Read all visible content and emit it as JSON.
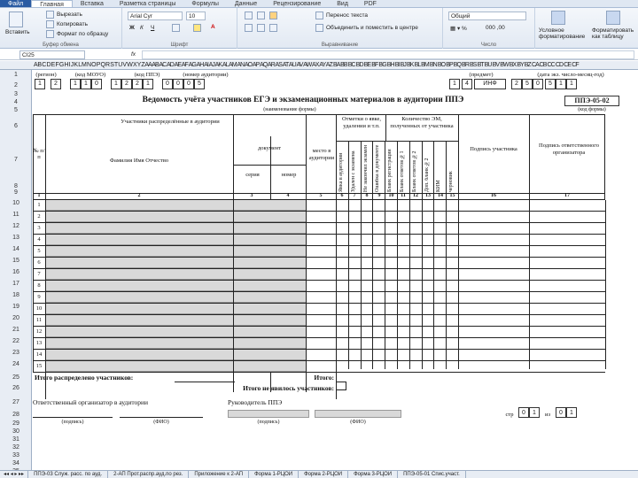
{
  "tabs": [
    "Файл",
    "Главная",
    "Вставка",
    "Разметка страницы",
    "Формулы",
    "Данные",
    "Рецензирование",
    "Вид",
    "PDF"
  ],
  "ribbon": {
    "cut": "Вырезать",
    "copy": "Копировать",
    "paste": "Вставить",
    "format_painter": "Формат по образцу",
    "clipboard_group": "Буфер обмена",
    "font_name": "Arial Cyr",
    "font_size": "10",
    "font_group": "Шрифт",
    "wrap_text": "Перенос текста",
    "merge_center": "Объединить и поместить в центре",
    "alignment_group": "Выравнивание",
    "number_format": "Общий",
    "number_group": "Число",
    "conditional": "Условное форматирование",
    "format_table": "Форматировать как таблицу"
  },
  "formula_bar": {
    "name_box": "CI25",
    "fx": "fx",
    "value": ""
  },
  "column_headers": "A B C D E F G H I J K L M N O P Q R S T U V W X Y Z AA AB AC AD AE AF AG AH AI AJ AK AL AM AN AO AP AQ AR AS AT AU AV AW AX AY AZ BA BB BC BD BE BF BG BH BI BJ BK BL BM BN BO BP BQ BR BS BT BU BV BW BX BY BZ CA CB CC CD CE CF",
  "form": {
    "region_label": "(регион)",
    "mouo_label": "(код МОУО)",
    "ppe_code_label": "(код ППЭ)",
    "room_label": "(номер аудитории)",
    "subject_label": "(предмет)",
    "date_label": "(дата экз. число-месяц-год)",
    "row2_left": [
      "1",
      "2",
      "1",
      "1",
      "0",
      "1",
      "2",
      "2",
      "1",
      "0",
      "0",
      "0",
      "5"
    ],
    "row2_right": [
      "1",
      "4",
      "ИНФ",
      "2",
      "5",
      "0",
      "5",
      "1",
      "1"
    ],
    "title": "Ведомость учёта участников ЕГЭ и экзаменационных материалов в аудитории ППЭ",
    "form_code": "ППЭ-05-02",
    "title_note": "(наименование формы)",
    "form_code_note": "(код формы)",
    "participants_header": "Участники распределённые в аудитории",
    "marks_header": "Отметки о явке, удалении и т.п.",
    "em_header": "Количество ЭМ, полученных от участника",
    "no_label": "№ п/п",
    "fio_label": "Фамилия Имя Отчество",
    "document_label": "документ",
    "series_label": "серия",
    "number_label": "номер",
    "seat_label": "место в аудитории",
    "vertical_labels": [
      "Явка в аудитории",
      "Удален с экзамена",
      "Не закончил экзамен",
      "Ошибка в документе",
      "Бланк регистрации",
      "Бланк ответов №1",
      "Бланк ответов №2",
      "Доп. бланк №2",
      "КИМ",
      "черновик"
    ],
    "signature_participant": "Подпись участника",
    "signature_organizer": "Подпись ответственного организатора",
    "col_numbers": [
      "1",
      "2",
      "3",
      "4",
      "5",
      "6",
      "7",
      "8",
      "9",
      "10",
      "11",
      "12",
      "13",
      "14",
      "15",
      "16",
      "17"
    ],
    "row_indices": [
      "1",
      "2",
      "3",
      "4",
      "5",
      "6",
      "7",
      "8",
      "9",
      "10",
      "11",
      "12",
      "13",
      "14",
      "15"
    ],
    "distributed": "Итого распределено участников:",
    "total": "Итого:",
    "absent": "Итого не явилось участников:",
    "organizer": "Ответственный организатор в аудитории",
    "ppe_head": "Руководитель ППЭ",
    "signature_note": "(подпись)",
    "fio_note": "(ФИО)",
    "page_label": "стр",
    "page_of": "из",
    "page_num": [
      "0",
      "1"
    ],
    "page_total": [
      "0",
      "1"
    ]
  },
  "sheet_tabs": [
    "ППЭ-03 Служ. расс. по ауд.",
    "2-АП Прот.распр.ауд.по рез.",
    "Приложение к 2-АП",
    "Форма 1-РЦОИ",
    "Форма 2-РЦОИ",
    "Форма 3-РЦОИ",
    "ППЭ-05-01 Спис.участ."
  ]
}
